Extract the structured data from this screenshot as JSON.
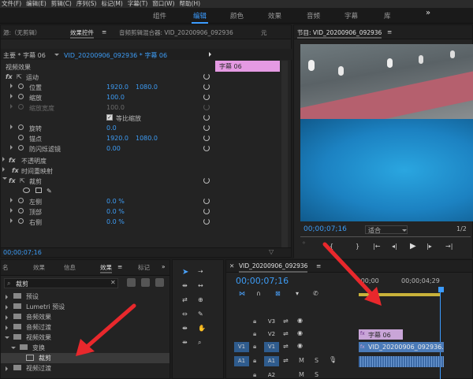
{
  "menubar": [
    "文件(F)",
    "编辑(E)",
    "剪辑(C)",
    "序列(S)",
    "标记(M)",
    "字幕(T)",
    "窗口(W)",
    "帮助(H)"
  ],
  "workspaces": [
    "组件",
    "编辑",
    "颜色",
    "效果",
    "音频",
    "字幕",
    "库"
  ],
  "workspace_more": "»",
  "source_panel": {
    "tabs": [
      "源:（无剪辑）",
      "效果控件",
      "音频剪辑混合器: VID_20200906_092936",
      "元"
    ],
    "menu_icon": "≡",
    "master": "主要 * 字幕 06",
    "sequence": "VID_20200906_092936 * 字幕 06",
    "video_effects": "视频效果",
    "clip_label": "字幕 06",
    "effects": {
      "motion": "运动",
      "position_label": "位置",
      "position_x": "1920.0",
      "position_y": "1080.0",
      "scale_label": "缩放",
      "scale_value": "100.0",
      "scale_width_label": "缩放宽度",
      "scale_width_value": "100.0",
      "uniform_scale_label": "等比缩放",
      "rotation_label": "旋转",
      "rotation_value": "0.0",
      "anchor_label": "锚点",
      "anchor_x": "1920.0",
      "anchor_y": "1080.0",
      "anti_flicker_label": "防闪烁滤镜",
      "anti_flicker_value": "0.00",
      "opacity": "不透明度",
      "time_remap": "时间重映射",
      "crop": "裁剪",
      "left_label": "左侧",
      "left_value": "0.0 %",
      "top_label": "顶部",
      "top_value": "0.0 %",
      "right_label": "右侧",
      "right_value": "0.0 %"
    },
    "timecode": "00;00;07;16"
  },
  "program_monitor": {
    "title": "节目: VID_20200906_092936",
    "menu_icon": "≡",
    "timecode": "00;00;07;16",
    "fit": "适合",
    "ratio": "1/2"
  },
  "project_panel": {
    "tabs": [
      "名",
      "效果",
      "信息",
      "效果",
      "标记"
    ],
    "more": "»",
    "search_value": "裁剪",
    "tree": [
      "预设",
      "Lumetri 预设",
      "音频效果",
      "音频过渡",
      "视频效果",
      "变换",
      "裁剪",
      "视频过渡"
    ]
  },
  "timeline": {
    "title": "VID_20200906_092936",
    "menu_icon": "≡",
    "timecode": "00;00;07;16",
    "ruler_start": ":00;00",
    "ruler_mid": "00;00;04;29",
    "tracks": [
      {
        "name": "V3"
      },
      {
        "name": "V2"
      },
      {
        "name": "V1",
        "src": "V1"
      },
      {
        "name": "A1",
        "src": "A1",
        "m": "M",
        "s": "S"
      },
      {
        "name": "A2",
        "m": "M",
        "s": "S"
      }
    ],
    "clips": {
      "title_clip": "字幕 06",
      "video_clip": "VID_20200906_092936.m"
    }
  },
  "colors": {
    "accent": "#3b9bff",
    "title_clip": "#c9a5d8",
    "label_pink": "#e59ae3",
    "arrow": "#e8282c"
  }
}
